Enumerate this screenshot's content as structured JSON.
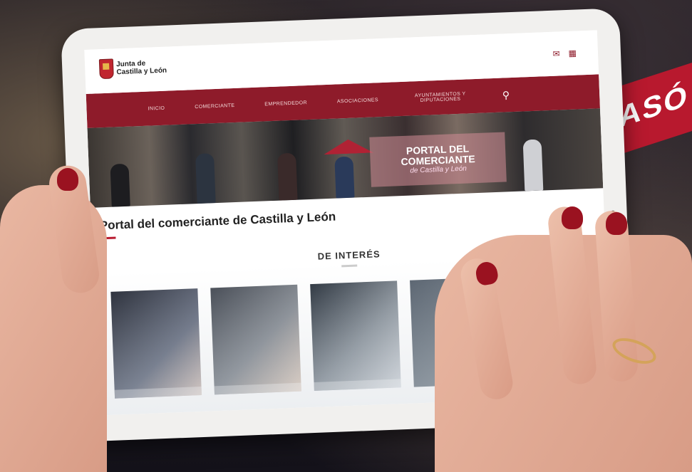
{
  "banner": {
    "text": "ASÓ"
  },
  "site": {
    "logo": {
      "line1": "Junta de",
      "line2": "Castilla y León"
    },
    "header_icons": [
      "mail-icon",
      "grid-icon"
    ],
    "nav": [
      "INICIO",
      "COMERCIANTE",
      "EMPRENDEDOR",
      "ASOCIACIONES",
      "AYUNTAMIENTOS Y DIPUTACIONES"
    ],
    "search_icon": "search-icon"
  },
  "hero": {
    "line1": "PORTAL DEL",
    "line2": "COMERCIANTE",
    "line3": "de Castilla y León"
  },
  "page_title": "Portal del comerciante de Castilla y León",
  "section_title": "DE INTERÉS",
  "colors": {
    "brand": "#8e1b2a",
    "banner": "#b8192e",
    "nail": "#9a1220"
  }
}
